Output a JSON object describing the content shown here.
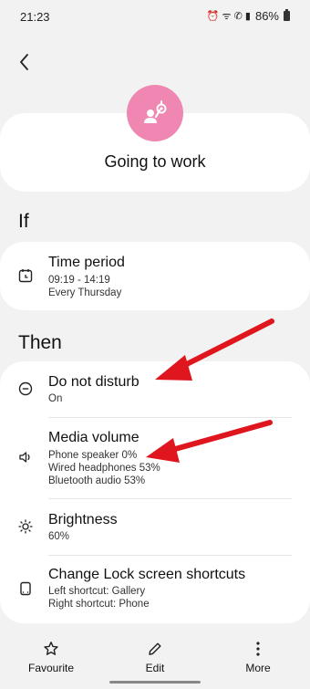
{
  "status_bar": {
    "time": "21:23",
    "icons": "⏰ ᯤ ✆ ▮",
    "battery": "86%"
  },
  "header": {
    "back_icon": "chevron-left-icon"
  },
  "routine": {
    "title": "Going to work",
    "icon": "person-icon",
    "icon_color": "#f087b2"
  },
  "if_section": {
    "heading": "If",
    "condition": {
      "title": "Time period",
      "line1": "09:19 - 14:19",
      "line2": "Every Thursday",
      "icon": "calendar-clock-icon"
    }
  },
  "then_section": {
    "heading": "Then",
    "actions": [
      {
        "title": "Do not disturb",
        "lines": [
          "On"
        ],
        "icon": "minus-circle-icon"
      },
      {
        "title": "Media volume",
        "lines": [
          "Phone speaker 0%",
          "Wired headphones 53%",
          "Bluetooth audio 53%"
        ],
        "icon": "speaker-icon"
      },
      {
        "title": "Brightness",
        "lines": [
          "60%"
        ],
        "icon": "sun-icon"
      },
      {
        "title": "Change Lock screen shortcuts",
        "lines": [
          "Left shortcut: Gallery",
          "Right shortcut: Phone"
        ],
        "icon": "phone-outline-icon"
      }
    ]
  },
  "bottom_bar": {
    "favourite": {
      "label": "Favourite",
      "icon": "star-icon"
    },
    "edit": {
      "label": "Edit",
      "icon": "pencil-icon"
    },
    "more": {
      "label": "More",
      "icon": "more-vertical-icon"
    }
  },
  "annotation_color": "#e0161e"
}
